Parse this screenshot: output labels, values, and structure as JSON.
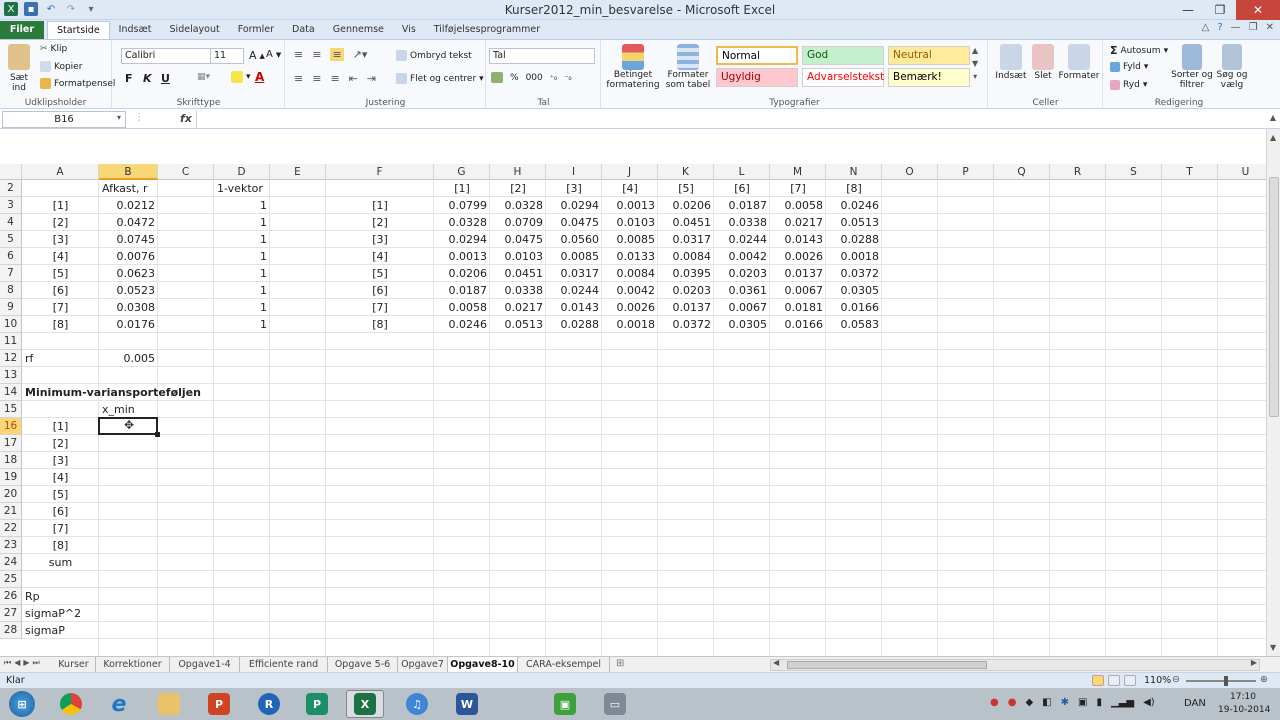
{
  "window": {
    "title": "Kurser2012_min_besvarelse - Microsoft Excel"
  },
  "tabs": [
    "Filer",
    "Startside",
    "Indsæt",
    "Sidelayout",
    "Formler",
    "Data",
    "Gennemse",
    "Vis",
    "Tilføjelsesprogrammer"
  ],
  "ribbon": {
    "clipboard": {
      "paste": "Sæt",
      "paste2": "ind",
      "cut": "Klip",
      "copy": "Kopier",
      "format_painter": "Formatpensel",
      "label": "Udklipsholder"
    },
    "font": {
      "name": "Calibri",
      "size": "11",
      "bold": "F",
      "italic": "K",
      "underline": "U",
      "label": "Skrifttype"
    },
    "alignment": {
      "wrap": "Ombryd tekst",
      "merge": "Flet og centrer",
      "label": "Justering"
    },
    "number": {
      "format": "Tal",
      "percent": "%",
      "thousands": "000",
      "label": "Tal"
    },
    "styles_group": {
      "conditional": "Betinget",
      "conditional2": "formatering",
      "table": "Formater",
      "table2": "som tabel",
      "label": "Typografier"
    },
    "styles": [
      {
        "name": "Normal",
        "bg": "#ffffff",
        "fg": "#000000"
      },
      {
        "name": "God",
        "bg": "#c6efce",
        "fg": "#006100"
      },
      {
        "name": "Neutral",
        "bg": "#ffeb9c",
        "fg": "#9c5700"
      },
      {
        "name": "Ugyldig",
        "bg": "#ffc7ce",
        "fg": "#9c0006"
      },
      {
        "name": "Advarselstekst",
        "bg": "#ffffff",
        "fg": "#ff0000"
      },
      {
        "name": "Bemærk!",
        "bg": "#ffffcc",
        "fg": "#000000"
      }
    ],
    "cells": {
      "insert": "Indsæt",
      "delete": "Slet",
      "format": "Formater",
      "label": "Celler"
    },
    "editing": {
      "autosum": "Autosum",
      "fill": "Fyld",
      "clear": "Ryd",
      "sort": "Sorter og",
      "sort2": "filtrer",
      "find": "Søg og",
      "find2": "vælg",
      "label": "Redigering"
    }
  },
  "formula_bar": {
    "name_box": "B16",
    "fx": "fx",
    "value": ""
  },
  "columns": [
    "A",
    "B",
    "C",
    "D",
    "E",
    "F",
    "G",
    "H",
    "I",
    "J",
    "K",
    "L",
    "M",
    "N",
    "O",
    "P",
    "Q",
    "R",
    "S",
    "T",
    "U"
  ],
  "rows": [
    "2",
    "3",
    "4",
    "5",
    "6",
    "7",
    "8",
    "9",
    "10",
    "11",
    "12",
    "13",
    "14",
    "15",
    "16",
    "17",
    "18",
    "19",
    "20",
    "21",
    "22",
    "23",
    "24",
    "25",
    "26",
    "27",
    "28"
  ],
  "sheet": {
    "headers": {
      "B2": "Afkast, r",
      "D2": "1-vektor"
    },
    "cov_headers": [
      "[1]",
      "[2]",
      "[3]",
      "[4]",
      "[5]",
      "[6]",
      "[7]",
      "[8]"
    ],
    "asset_labels": [
      "[1]",
      "[2]",
      "[3]",
      "[4]",
      "[5]",
      "[6]",
      "[7]",
      "[8]"
    ],
    "returns": [
      "0.0212",
      "0.0472",
      "0.0745",
      "0.0076",
      "0.0623",
      "0.0523",
      "0.0308",
      "0.0176"
    ],
    "ones": [
      "1",
      "1",
      "1",
      "1",
      "1",
      "1",
      "1",
      "1"
    ],
    "cov_matrix": [
      [
        "0.0799",
        "0.0328",
        "0.0294",
        "0.0013",
        "0.0206",
        "0.0187",
        "0.0058",
        "0.0246"
      ],
      [
        "0.0328",
        "0.0709",
        "0.0475",
        "0.0103",
        "0.0451",
        "0.0338",
        "0.0217",
        "0.0513"
      ],
      [
        "0.0294",
        "0.0475",
        "0.0560",
        "0.0085",
        "0.0317",
        "0.0244",
        "0.0143",
        "0.0288"
      ],
      [
        "0.0013",
        "0.0103",
        "0.0085",
        "0.0133",
        "0.0084",
        "0.0042",
        "0.0026",
        "0.0018"
      ],
      [
        "0.0206",
        "0.0451",
        "0.0317",
        "0.0084",
        "0.0395",
        "0.0203",
        "0.0137",
        "0.0372"
      ],
      [
        "0.0187",
        "0.0338",
        "0.0244",
        "0.0042",
        "0.0203",
        "0.0361",
        "0.0067",
        "0.0305"
      ],
      [
        "0.0058",
        "0.0217",
        "0.0143",
        "0.0026",
        "0.0137",
        "0.0067",
        "0.0181",
        "0.0166"
      ],
      [
        "0.0246",
        "0.0513",
        "0.0288",
        "0.0018",
        "0.0372",
        "0.0305",
        "0.0166",
        "0.0583"
      ]
    ],
    "rf_label": "rf",
    "rf_value": "0.005",
    "section_title": "Minimum-variansporteføljen",
    "xmin_label": "x_min",
    "portfolio_labels": [
      "[1]",
      "[2]",
      "[3]",
      "[4]",
      "[5]",
      "[6]",
      "[7]",
      "[8]"
    ],
    "sum_label": "sum",
    "rp_label": "Rp",
    "sigma2_label": "sigmaP^2",
    "sigma_label": "sigmaP"
  },
  "sheet_tabs": [
    "Kurser",
    "Korrektioner",
    "Opgave1-4",
    "Efficiente rand",
    "Opgave 5-6",
    "Opgave7",
    "Opgave8-10",
    "CARA-eksempel"
  ],
  "active_sheet": "Opgave8-10",
  "status": {
    "ready": "Klar",
    "zoom": "110%"
  },
  "taskbar": {
    "lang": "DAN",
    "time": "17:10",
    "date": "19-10-2014"
  }
}
